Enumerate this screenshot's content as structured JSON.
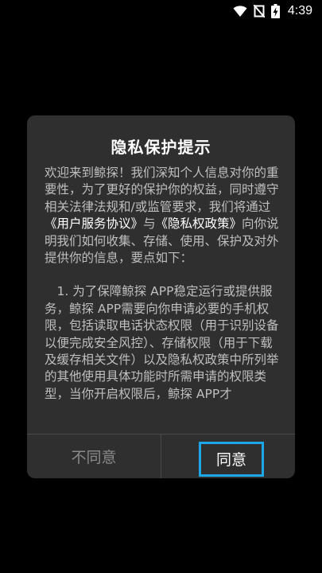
{
  "status_bar": {
    "time": "4:39",
    "icons": [
      "wifi-icon",
      "no-sim-icon",
      "battery-charging-icon"
    ]
  },
  "dialog": {
    "title": "隐私保护提示",
    "paragraph1_before": "欢迎来到鲸探！我们深知个人信息对你的重要性，为了更好的保护你的权益，同时遵守相关法律法规和/或监管要求，我们将通过",
    "link_user_agreement": "《用户服务协议》",
    "and_text": "与",
    "link_privacy_policy": "《隐私权政策》",
    "paragraph1_after": "向你说明我们如何收集、存储、使用、保护及对外提供你的信息，要点如下：",
    "paragraph2": "　1. 为了保障鲸探 APP稳定运行或提供服务，鲸探 APP需要向你申请必要的手机权限，包括读取电话状态权限（用于识别设备以便完成安全风控）、存储权限（用于下载及缓存相关文件）以及隐私权政策中所列举的其他使用具体功能时所需申请的权限类型，当你开启权限后，鲸探 APP才",
    "disagree_label": "不同意",
    "agree_label": "同意"
  },
  "colors": {
    "dialog_bg": "#2f2f2f",
    "highlight_border": "#1ea7e8"
  }
}
